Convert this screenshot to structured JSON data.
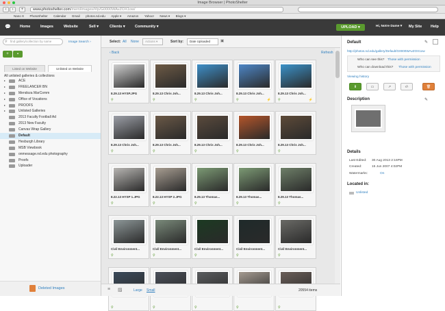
{
  "window": {
    "title": "Image Browser | PhotoShelter"
  },
  "browser": {
    "url_domain": "www.photoshelter.com",
    "url_path": "/mem/images/#/p/G0000WAvZOX1ow/",
    "search_placeholder": "",
    "bookmarks": [
      "Nano X",
      "PhotoShelter",
      "Calendar",
      "Gmail",
      "photos.nd.edu",
      "Apple ▾",
      "Amazon",
      "Yahoo!",
      "News ▾",
      "Blogs ▾"
    ]
  },
  "nav": {
    "items": [
      "Home",
      "Images",
      "Website",
      "Sell ▾",
      "Clients ▾",
      "Community ▾"
    ],
    "upload": "UPLOAD ▾",
    "user": "Hi, Notre Dame ▾",
    "my_site": "My Site",
    "help": "Help"
  },
  "left": {
    "search_placeholder": "find gallery/collection by name",
    "image_search": "Image Search ›",
    "tabs": [
      "Listed on Website",
      "Unlisted on Website"
    ],
    "all_label": "All unlisted galleries & collections",
    "tree": [
      {
        "label": "ACE",
        "arrow": "▸"
      },
      {
        "label": "FREELANCER BN",
        "arrow": "▸"
      },
      {
        "label": "Mendoza MarComm",
        "arrow": "▸"
      },
      {
        "label": "Office of Vocations",
        "arrow": "▸"
      },
      {
        "label": "PROOFS",
        "arrow": "▸"
      },
      {
        "label": "Unlisted Galleries",
        "arrow": "▸"
      },
      {
        "label": "2013 Faculty Football Ad",
        "arrow": ""
      },
      {
        "label": "2013 New Faculty",
        "arrow": ""
      },
      {
        "label": "Canvas Wrap Gallery",
        "arrow": ""
      },
      {
        "label": "Default",
        "arrow": ""
      },
      {
        "label": "Hesburgh Library",
        "arrow": ""
      },
      {
        "label": "MSB Viewbook",
        "arrow": ""
      },
      {
        "label": "onmessage.nd.edu photography",
        "arrow": ""
      },
      {
        "label": "Proofs",
        "arrow": ""
      },
      {
        "label": "Uploader",
        "arrow": ""
      }
    ],
    "deleted": "Deleted Images"
  },
  "mid": {
    "select": "Select:",
    "all": "All",
    "none": "None",
    "actions": "Actions ▾",
    "sort_label": "Sort by:",
    "sort_value": "Date Uploaded",
    "back": "‹ Back",
    "refresh": "Refresh",
    "large": "Large",
    "small": "Small",
    "count": "20554 items",
    "rows": [
      [
        {
          "cap": "8.29.13 HYSP.JPG",
          "c": "#cfcfcf"
        },
        {
          "cap": "8.29.13 Chris Joh...",
          "c": "#6d5a45"
        },
        {
          "cap": "8.29.13 Chris Joh...",
          "c": "#3e8fc8"
        },
        {
          "cap": "8.29.13 Chris Joh...",
          "c": "#4d86c6"
        },
        {
          "cap": "8.29.13 Chris Joh...",
          "c": "#3b92c9"
        }
      ],
      [
        {
          "cap": "8.29.13 Chris Joh...",
          "c": "#9c9fa7"
        },
        {
          "cap": "8.29.13 Chris Joh...",
          "c": "#6a5846"
        },
        {
          "cap": "8.29.13 Chris Joh...",
          "c": "#5a4a3c"
        },
        {
          "cap": "8.29.13 Chris Joh...",
          "c": "#b4552a"
        },
        {
          "cap": "8.29.13 Chris Joh...",
          "c": "#5d4a38"
        }
      ],
      [
        {
          "cap": "8.22.13 HYSP 1.JPG",
          "c": "#b8b6b3"
        },
        {
          "cap": "8.22.13 HYSP 2.JPG",
          "c": "#a89e92"
        },
        {
          "cap": "8.29.13 Thomas...",
          "c": "#7c9a74"
        },
        {
          "cap": "8.29.13 Thomas...",
          "c": "#7c9a74"
        },
        {
          "cap": "8.29.13 Thomas...",
          "c": "#6e7f68"
        }
      ],
      [
        {
          "cap": "Civil Environment...",
          "c": "#8d9798"
        },
        {
          "cap": "Civil Environment...",
          "c": "#7a8a7a"
        },
        {
          "cap": "Civil Environment...",
          "c": "#1c3a22"
        },
        {
          "cap": "Civil Environment...",
          "c": "#1f2a2a"
        },
        {
          "cap": "Civil Environment...",
          "c": "#6a6a66"
        }
      ],
      [
        {
          "cap": "",
          "c": "#3b4a5a"
        },
        {
          "cap": "",
          "c": "#4a4f58"
        },
        {
          "cap": "",
          "c": "#5a5c5e"
        },
        {
          "cap": "",
          "c": "#a49a90"
        },
        {
          "cap": "",
          "c": "#6a5e58"
        }
      ]
    ]
  },
  "right": {
    "default_title": "Default",
    "url": "http://photos.nd.edu/gallery/Default/G0000WAvZOX1ow",
    "see_label": "Who can see this?",
    "see_link": "Those with permission",
    "dl_label": "Who can download this?",
    "dl_link": "Those with permission",
    "history": "Viewing history",
    "desc_title": "Description",
    "details_title": "Details",
    "details": [
      {
        "k": "Last Edited:",
        "v": "30 Aug 2013 2:16PM"
      },
      {
        "k": "Created:",
        "v": "15 Jun 2007 4:02PM"
      },
      {
        "k": "Watermarks:",
        "v": "On"
      }
    ],
    "located_title": "Located in:",
    "located": "Unlisted"
  }
}
